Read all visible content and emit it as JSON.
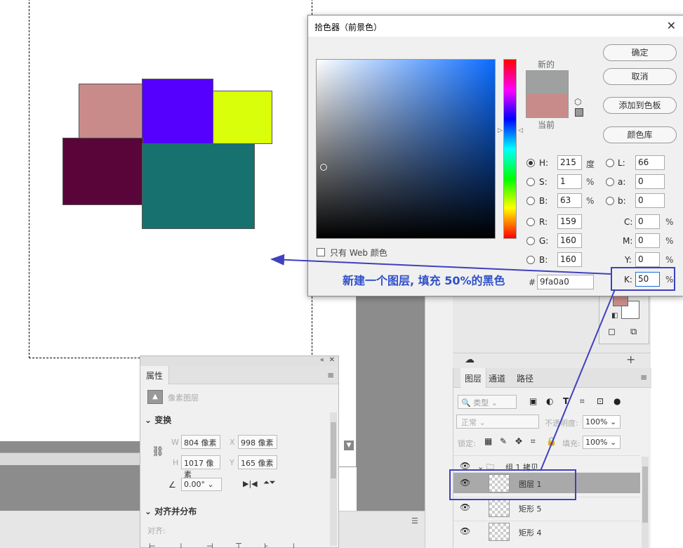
{
  "canvas": {
    "shapes": [
      {
        "name": "pink-rect",
        "color": "#c98b89"
      },
      {
        "name": "purple-rect",
        "color": "#5500ff"
      },
      {
        "name": "yellow-rect",
        "color": "#d9ff0a"
      },
      {
        "name": "maroon-rect",
        "color": "#5a053a"
      },
      {
        "name": "teal-rect",
        "color": "#17716e"
      }
    ]
  },
  "picker": {
    "title": "拾色器（前景色）",
    "new_label": "新的",
    "current_label": "当前",
    "new_color": "#9fa0a0",
    "current_color": "#c98b89",
    "buttons": {
      "ok": "确定",
      "cancel": "取消",
      "add_swatch": "添加到色板",
      "libraries": "颜色库"
    },
    "hsb": {
      "h_label": "H:",
      "h": "215",
      "h_unit": "度",
      "s_label": "S:",
      "s": "1",
      "s_unit": "%",
      "b_label": "B:",
      "b": "63",
      "b_unit": "%"
    },
    "lab": {
      "l_label": "L:",
      "l": "66",
      "a_label": "a:",
      "a": "0",
      "b_label": "b:",
      "b": "0"
    },
    "rgb": {
      "r_label": "R:",
      "r": "159",
      "g_label": "G:",
      "g": "160",
      "b_label": "B:",
      "b": "160"
    },
    "cmyk": {
      "c_label": "C:",
      "c": "0",
      "m_label": "M:",
      "m": "0",
      "y_label": "Y:",
      "y": "0",
      "k_label": "K:",
      "k": "50",
      "unit": "%"
    },
    "web_only": "只有 Web 颜色",
    "hash": "#",
    "hex": "9fa0a0"
  },
  "annotation": {
    "text": "新建一个图层, 填充 50%的黑色",
    "color": "#3050c8"
  },
  "layers": {
    "tabs": [
      "图层",
      "通道",
      "路径"
    ],
    "menu_icon": "≡",
    "filter_placeholder": "类型",
    "blend_mode": "正常",
    "opacity_label": "不透明度:",
    "opacity": "100%",
    "lock_label": "锁定:",
    "fill_label": "填充:",
    "fill": "100%",
    "rows": [
      {
        "name": "组 1 拷贝",
        "type": "group"
      },
      {
        "name": "图层 1",
        "type": "pixel",
        "selected": true
      },
      {
        "name": "矩形 5",
        "type": "shape"
      },
      {
        "name": "矩形 4",
        "type": "shape"
      }
    ]
  },
  "properties": {
    "tab": "属性",
    "layer_kind": "像素图层",
    "transform_head": "变换",
    "w_label": "W",
    "w": "804 像素",
    "x_label": "X",
    "x": "998 像素",
    "h_label": "H",
    "h": "1017 像素",
    "y_label": "Y",
    "y": "165 像素",
    "angle": "0.00°",
    "align_head": "对齐并分布",
    "align_label": "对齐:"
  }
}
